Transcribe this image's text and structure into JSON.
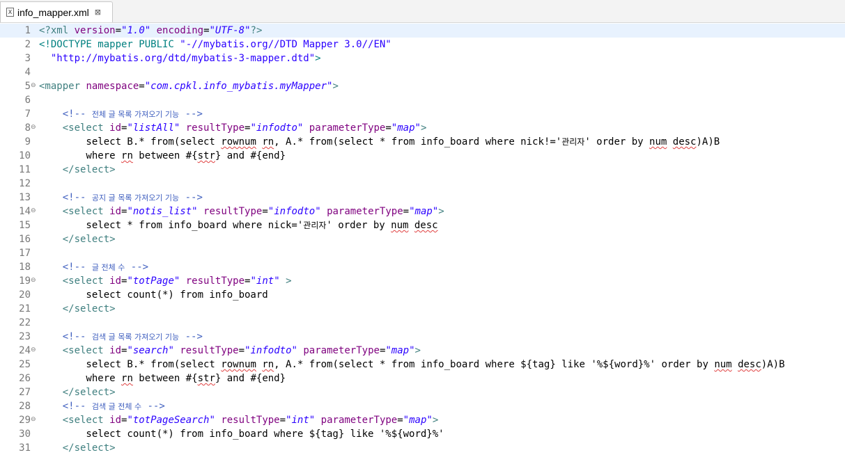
{
  "tab": {
    "title": "info_mapper.xml",
    "close_glyph": "⊠",
    "file_icon": "X"
  },
  "editor": {
    "current_line": 1,
    "lines": [
      {
        "n": "1",
        "segs": [
          [
            "pi",
            "<?xml "
          ],
          [
            "attr",
            "version"
          ],
          [
            "txt",
            "="
          ],
          [
            "val",
            "\"1.0\""
          ],
          [
            "txt",
            " "
          ],
          [
            "attr",
            "encoding"
          ],
          [
            "txt",
            "="
          ],
          [
            "val",
            "\"UTF-8\""
          ],
          [
            "pi",
            "?>"
          ]
        ]
      },
      {
        "n": "2",
        "segs": [
          [
            "dt",
            "<!DOCTYPE mapper PUBLIC "
          ],
          [
            "dts",
            "\"-//mybatis.org//DTD Mapper 3.0//EN\""
          ]
        ]
      },
      {
        "n": "3",
        "segs": [
          [
            "dts",
            "  \"http://mybatis.org/dtd/mybatis-3-mapper.dtd\""
          ],
          [
            "dt",
            ">"
          ]
        ]
      },
      {
        "n": "4",
        "segs": []
      },
      {
        "n": "5",
        "fold": "⊖",
        "segs": [
          [
            "tag",
            "<mapper "
          ],
          [
            "attr",
            "namespace"
          ],
          [
            "txt",
            "="
          ],
          [
            "val",
            "\"com.cpkl.info_mybatis.myMapper\""
          ],
          [
            "tag",
            ">"
          ]
        ]
      },
      {
        "n": "6",
        "segs": []
      },
      {
        "n": "7",
        "segs": [
          [
            "cm",
            "    <!-- "
          ],
          [
            "cmk",
            "전체 글 목록 가져오기 기능"
          ],
          [
            "cm",
            " -->"
          ]
        ]
      },
      {
        "n": "8",
        "fold": "⊖",
        "segs": [
          [
            "tag",
            "    <select "
          ],
          [
            "attr",
            "id"
          ],
          [
            "txt",
            "="
          ],
          [
            "val",
            "\"listAll\""
          ],
          [
            "txt",
            " "
          ],
          [
            "attr",
            "resultType"
          ],
          [
            "txt",
            "="
          ],
          [
            "val",
            "\"infodto\""
          ],
          [
            "txt",
            " "
          ],
          [
            "attr",
            "parameterType"
          ],
          [
            "txt",
            "="
          ],
          [
            "val",
            "\"map\""
          ],
          [
            "tag",
            ">"
          ]
        ]
      },
      {
        "n": "9",
        "segs": [
          [
            "txt",
            "        select B.* from(select "
          ],
          [
            "sq",
            "rownum"
          ],
          [
            "txt",
            " "
          ],
          [
            "sq",
            "rn"
          ],
          [
            "txt",
            ", A.* from(select * from info_board where nick!='"
          ],
          [
            "ko",
            "관리자"
          ],
          [
            "txt",
            "' order by "
          ],
          [
            "sq",
            "num"
          ],
          [
            "txt",
            " "
          ],
          [
            "sq",
            "desc"
          ],
          [
            "txt",
            ")A)B"
          ]
        ]
      },
      {
        "n": "10",
        "segs": [
          [
            "txt",
            "        where "
          ],
          [
            "sq",
            "rn"
          ],
          [
            "txt",
            " between #{"
          ],
          [
            "sq",
            "str"
          ],
          [
            "txt",
            "} and #{end}"
          ]
        ]
      },
      {
        "n": "11",
        "segs": [
          [
            "tag",
            "    </select>"
          ]
        ]
      },
      {
        "n": "12",
        "segs": []
      },
      {
        "n": "13",
        "segs": [
          [
            "cm",
            "    <!-- "
          ],
          [
            "cmk",
            "공지 글 목록 가져오기 기능"
          ],
          [
            "cm",
            " -->"
          ]
        ]
      },
      {
        "n": "14",
        "fold": "⊖",
        "segs": [
          [
            "tag",
            "    <select "
          ],
          [
            "attr",
            "id"
          ],
          [
            "txt",
            "="
          ],
          [
            "val",
            "\"notis_list\""
          ],
          [
            "txt",
            " "
          ],
          [
            "attr",
            "resultType"
          ],
          [
            "txt",
            "="
          ],
          [
            "val",
            "\"infodto\""
          ],
          [
            "txt",
            " "
          ],
          [
            "attr",
            "parameterType"
          ],
          [
            "txt",
            "="
          ],
          [
            "val",
            "\"map\""
          ],
          [
            "tag",
            ">"
          ]
        ]
      },
      {
        "n": "15",
        "segs": [
          [
            "txt",
            "        select * from info_board where nick='"
          ],
          [
            "ko",
            "관리자"
          ],
          [
            "txt",
            "' order by "
          ],
          [
            "sq",
            "num"
          ],
          [
            "txt",
            " "
          ],
          [
            "sq",
            "desc"
          ]
        ]
      },
      {
        "n": "16",
        "segs": [
          [
            "tag",
            "    </select>"
          ]
        ]
      },
      {
        "n": "17",
        "segs": []
      },
      {
        "n": "18",
        "segs": [
          [
            "cm",
            "    <!-- "
          ],
          [
            "cmk",
            "글 전체 수"
          ],
          [
            "cm",
            " -->"
          ]
        ]
      },
      {
        "n": "19",
        "fold": "⊖",
        "segs": [
          [
            "tag",
            "    <select "
          ],
          [
            "attr",
            "id"
          ],
          [
            "txt",
            "="
          ],
          [
            "val",
            "\"totPage\""
          ],
          [
            "txt",
            " "
          ],
          [
            "attr",
            "resultType"
          ],
          [
            "txt",
            "="
          ],
          [
            "val",
            "\"int\""
          ],
          [
            "tag",
            " >"
          ]
        ]
      },
      {
        "n": "20",
        "segs": [
          [
            "txt",
            "        select count(*) from info_board"
          ]
        ]
      },
      {
        "n": "21",
        "segs": [
          [
            "tag",
            "    </select>"
          ]
        ]
      },
      {
        "n": "22",
        "segs": []
      },
      {
        "n": "23",
        "segs": [
          [
            "cm",
            "    <!-- "
          ],
          [
            "cmk",
            "검색 글 목록 가져오기 기능"
          ],
          [
            "cm",
            " -->"
          ]
        ]
      },
      {
        "n": "24",
        "fold": "⊖",
        "segs": [
          [
            "tag",
            "    <select "
          ],
          [
            "attr",
            "id"
          ],
          [
            "txt",
            "="
          ],
          [
            "val",
            "\"search\""
          ],
          [
            "txt",
            " "
          ],
          [
            "attr",
            "resultType"
          ],
          [
            "txt",
            "="
          ],
          [
            "val",
            "\"infodto\""
          ],
          [
            "txt",
            " "
          ],
          [
            "attr",
            "parameterType"
          ],
          [
            "txt",
            "="
          ],
          [
            "val",
            "\"map\""
          ],
          [
            "tag",
            ">"
          ]
        ]
      },
      {
        "n": "25",
        "segs": [
          [
            "txt",
            "        select B.* from(select "
          ],
          [
            "sq",
            "rownum"
          ],
          [
            "txt",
            " "
          ],
          [
            "sq",
            "rn"
          ],
          [
            "txt",
            ", A.* from(select * from info_board where ${tag} like '%${word}%' order by "
          ],
          [
            "sq",
            "num"
          ],
          [
            "txt",
            " "
          ],
          [
            "sq",
            "desc"
          ],
          [
            "txt",
            ")A)B"
          ]
        ]
      },
      {
        "n": "26",
        "segs": [
          [
            "txt",
            "        where "
          ],
          [
            "sq",
            "rn"
          ],
          [
            "txt",
            " between #{"
          ],
          [
            "sq",
            "str"
          ],
          [
            "txt",
            "} and #{end}"
          ]
        ]
      },
      {
        "n": "27",
        "segs": [
          [
            "tag",
            "    </select>"
          ]
        ]
      },
      {
        "n": "28",
        "segs": [
          [
            "cm",
            "    <!-- "
          ],
          [
            "cmk",
            "검색 글 전체 수"
          ],
          [
            "cm",
            " -->"
          ]
        ]
      },
      {
        "n": "29",
        "fold": "⊖",
        "segs": [
          [
            "tag",
            "    <select "
          ],
          [
            "attr",
            "id"
          ],
          [
            "txt",
            "="
          ],
          [
            "val",
            "\"totPageSearch\""
          ],
          [
            "txt",
            " "
          ],
          [
            "attr",
            "resultType"
          ],
          [
            "txt",
            "="
          ],
          [
            "val",
            "\"int\""
          ],
          [
            "txt",
            " "
          ],
          [
            "attr",
            "parameterType"
          ],
          [
            "txt",
            "="
          ],
          [
            "val",
            "\"map\""
          ],
          [
            "tag",
            ">"
          ]
        ]
      },
      {
        "n": "30",
        "segs": [
          [
            "txt",
            "        select count(*) from info_board where ${tag} like '%${word}%'"
          ]
        ]
      },
      {
        "n": "31",
        "segs": [
          [
            "tag",
            "    </select>"
          ]
        ]
      }
    ]
  }
}
